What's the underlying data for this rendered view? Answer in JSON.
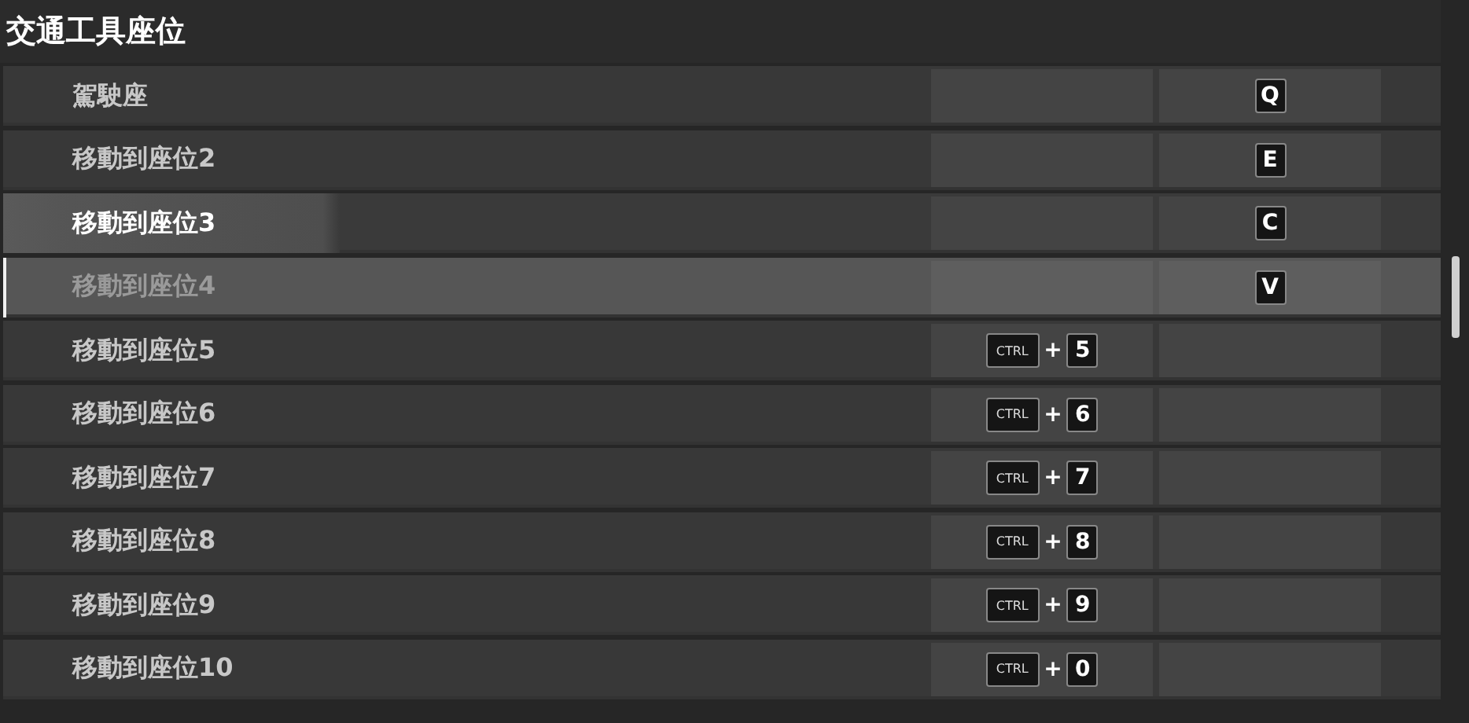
{
  "section": {
    "title": "交通工具座位"
  },
  "rows": [
    {
      "label": "駕駛座",
      "highlighted": false,
      "selected": false,
      "secondary": [
        {
          "kind": "key",
          "text": "Q"
        }
      ]
    },
    {
      "label": "移動到座位2",
      "highlighted": false,
      "selected": false,
      "secondary": [
        {
          "kind": "key",
          "text": "E"
        }
      ]
    },
    {
      "label": "移動到座位3",
      "highlighted": true,
      "selected": false,
      "secondary": [
        {
          "kind": "key",
          "text": "C"
        }
      ]
    },
    {
      "label": "移動到座位4",
      "highlighted": false,
      "selected": true,
      "secondary": [
        {
          "kind": "key",
          "text": "V"
        }
      ]
    },
    {
      "label": "移動到座位5",
      "highlighted": false,
      "selected": false,
      "primary": [
        {
          "kind": "modifier",
          "text": "CTRL"
        },
        {
          "kind": "plus",
          "text": "+"
        },
        {
          "kind": "key",
          "text": "5"
        }
      ]
    },
    {
      "label": "移動到座位6",
      "highlighted": false,
      "selected": false,
      "primary": [
        {
          "kind": "modifier",
          "text": "CTRL"
        },
        {
          "kind": "plus",
          "text": "+"
        },
        {
          "kind": "key",
          "text": "6"
        }
      ]
    },
    {
      "label": "移動到座位7",
      "highlighted": false,
      "selected": false,
      "primary": [
        {
          "kind": "modifier",
          "text": "CTRL"
        },
        {
          "kind": "plus",
          "text": "+"
        },
        {
          "kind": "key",
          "text": "7"
        }
      ]
    },
    {
      "label": "移動到座位8",
      "highlighted": false,
      "selected": false,
      "primary": [
        {
          "kind": "modifier",
          "text": "CTRL"
        },
        {
          "kind": "plus",
          "text": "+"
        },
        {
          "kind": "key",
          "text": "8"
        }
      ]
    },
    {
      "label": "移動到座位9",
      "highlighted": false,
      "selected": false,
      "primary": [
        {
          "kind": "modifier",
          "text": "CTRL"
        },
        {
          "kind": "plus",
          "text": "+"
        },
        {
          "kind": "key",
          "text": "9"
        }
      ]
    },
    {
      "label": "移動到座位10",
      "highlighted": false,
      "selected": false,
      "primary": [
        {
          "kind": "modifier",
          "text": "CTRL"
        },
        {
          "kind": "plus",
          "text": "+"
        },
        {
          "kind": "key",
          "text": "0"
        }
      ]
    }
  ]
}
